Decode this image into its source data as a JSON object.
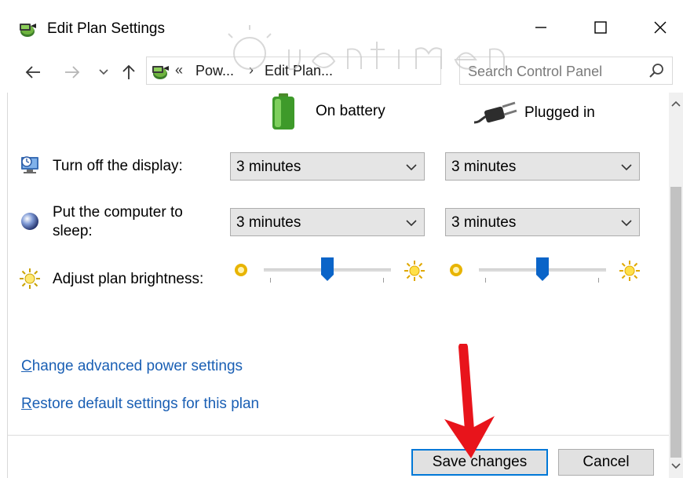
{
  "window": {
    "title": "Edit Plan Settings",
    "title_icon": "power-plan-icon"
  },
  "nav": {
    "back_icon": "arrow-left-icon",
    "forward_icon": "arrow-right-icon",
    "recent_icon": "chevron-down-icon",
    "up_icon": "arrow-up-icon"
  },
  "address": {
    "overflow": "«",
    "crumbs": [
      "Pow...",
      "Edit Plan..."
    ],
    "separator": "›"
  },
  "search": {
    "placeholder": "Search Control Panel"
  },
  "columns": {
    "battery_label": "On battery",
    "plugged_label": "Plugged in"
  },
  "settings": {
    "display": {
      "label": "Turn off the display:",
      "battery_value": "3 minutes",
      "plugged_value": "3 minutes"
    },
    "sleep": {
      "label_line1": "Put the computer to",
      "label_line2": "sleep:",
      "battery_value": "3 minutes",
      "plugged_value": "3 minutes"
    },
    "brightness": {
      "label": "Adjust plan brightness:",
      "battery_level": 0.5,
      "plugged_level": 0.5
    }
  },
  "links": {
    "advanced_first": "C",
    "advanced_rest": "hange advanced power settings",
    "restore_first": "R",
    "restore_rest": "estore default settings for this plan"
  },
  "buttons": {
    "save": "Save changes",
    "cancel": "Cancel"
  },
  "colors": {
    "accent": "#0078d7",
    "link": "#1a5fb4",
    "arrow": "#e8141b",
    "slider_thumb": "#0a64c8"
  }
}
